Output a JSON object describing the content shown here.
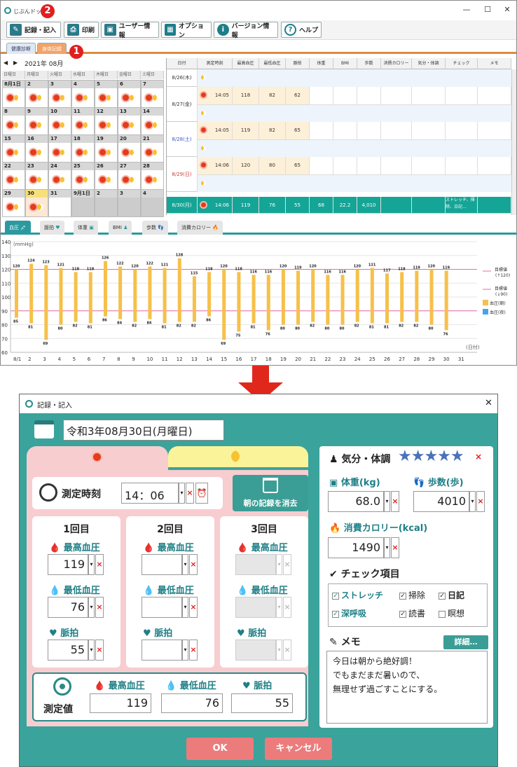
{
  "app": {
    "title": "じぶんドック"
  },
  "window_controls": {
    "minimize": "—",
    "maximize": "☐",
    "close": "✕"
  },
  "toolbar": {
    "buttons": [
      {
        "label": "記録・記入",
        "icon": "record-edit-icon"
      },
      {
        "label": "印刷",
        "icon": "printer-icon"
      },
      {
        "label": "ユーザー情報",
        "icon": "user-card-icon"
      },
      {
        "label": "オプション",
        "icon": "grid-icon"
      },
      {
        "label": "バージョン情報",
        "icon": "info-icon"
      },
      {
        "label": "ヘルプ",
        "icon": "help-icon"
      }
    ]
  },
  "annotations": {
    "badge1": "1",
    "badge2": "2"
  },
  "mode_tabs": [
    {
      "label": "健康診断"
    },
    {
      "label": "身体記録"
    }
  ],
  "calendar": {
    "month": "2021年 08月",
    "prev": "◀",
    "next": "▶",
    "dow": [
      "日曜日",
      "月曜日",
      "火曜日",
      "水曜日",
      "木曜日",
      "金曜日",
      "土曜日"
    ],
    "weeks": [
      [
        "8月1日",
        "2",
        "3",
        "4",
        "5",
        "6",
        "7"
      ],
      [
        "8",
        "9",
        "10",
        "11",
        "12",
        "13",
        "14"
      ],
      [
        "15",
        "16",
        "17",
        "18",
        "19",
        "20",
        "21"
      ],
      [
        "22",
        "23",
        "24",
        "25",
        "26",
        "27",
        "28"
      ],
      [
        "29",
        "30",
        "31",
        "9月1日",
        "2",
        "3",
        "4"
      ]
    ]
  },
  "grid": {
    "headers": [
      "日付",
      "測定時刻",
      "最高血圧",
      "最低血圧",
      "脈拍",
      "体重",
      "BMI",
      "歩数",
      "消費カロリー",
      "気分・体調",
      "チェック",
      "メモ"
    ],
    "rows": [
      {
        "date": "8/26(木)",
        "time": "",
        "sys": "",
        "dia": "",
        "pulse": "",
        "night": true
      },
      {
        "date": "8/27(金)",
        "time": "14:05",
        "sys": "118",
        "dia": "82",
        "pulse": "62"
      },
      {
        "date": "8/28(土)",
        "time": "14:05",
        "sys": "119",
        "dia": "82",
        "pulse": "65"
      },
      {
        "date": "8/29(日)",
        "time": "14:06",
        "sys": "120",
        "dia": "80",
        "pulse": "65"
      },
      {
        "date": "8/30(月)",
        "time": "14:06",
        "sys": "119",
        "dia": "76",
        "pulse": "55",
        "weight": "68",
        "bmi": "22.2",
        "steps": "4,010",
        "check": "ストレッチ、掃除、日記…"
      }
    ]
  },
  "chart_tabs": [
    {
      "label": "血圧"
    },
    {
      "label": "脈拍"
    },
    {
      "label": "体重"
    },
    {
      "label": "BMI"
    },
    {
      "label": "歩数"
    },
    {
      "label": "消費カロリー"
    }
  ],
  "chart_data": {
    "type": "bar",
    "ylabel": "(mmHg)",
    "xlabel": "(日付)",
    "ylim": [
      60,
      140
    ],
    "yticks": [
      60,
      70,
      80,
      90,
      100,
      110,
      120,
      130,
      140
    ],
    "categories": [
      "8/1",
      "2",
      "3",
      "4",
      "5",
      "6",
      "7",
      "8",
      "9",
      "10",
      "11",
      "12",
      "13",
      "14",
      "15",
      "16",
      "17",
      "18",
      "19",
      "20",
      "21",
      "22",
      "23",
      "24",
      "25",
      "26",
      "27",
      "28",
      "29",
      "30",
      "31"
    ],
    "series": [
      {
        "name": "血圧(朝)",
        "high": [
          120,
          124,
          123,
          121,
          118,
          118,
          126,
          122,
          120,
          122,
          121,
          128,
          115,
          118,
          120,
          118,
          116,
          116,
          120,
          119,
          120,
          116,
          116,
          120,
          121,
          117,
          118,
          119,
          120,
          119,
          null
        ],
        "low": [
          85,
          81,
          69,
          80,
          82,
          81,
          86,
          84,
          82,
          84,
          81,
          82,
          82,
          86,
          69,
          75,
          81,
          76,
          80,
          80,
          82,
          80,
          80,
          82,
          81,
          81,
          82,
          82,
          80,
          76,
          null
        ]
      },
      {
        "name": "血圧(夜)",
        "high": [],
        "low": []
      }
    ],
    "target_lines": [
      {
        "label": "目標値",
        "sub": "(↑120)",
        "value": 120
      },
      {
        "label": "目標値",
        "sub": "(↓90)",
        "value": 90
      }
    ],
    "colors": {
      "morning": "#f6c04a",
      "night": "#4aa3e8",
      "target": "#e86aa8"
    },
    "legend": "right"
  },
  "dialog": {
    "title": "記録・記入",
    "date": "令和3年08月30日(月曜日)",
    "time_label": "測定時刻",
    "time_value": "14：06",
    "clear_label": "朝の記録を消去",
    "rounds": [
      {
        "title": "1回目",
        "sys": "119",
        "dia": "76",
        "pulse": "55"
      },
      {
        "title": "2回目",
        "sys": "",
        "dia": "",
        "pulse": ""
      },
      {
        "title": "3回目",
        "sys": "",
        "dia": "",
        "pulse": ""
      }
    ],
    "sys_label": "最高血圧",
    "dia_label": "最低血圧",
    "pulse_label": "脈拍",
    "measured_label": "測定値",
    "measured": {
      "sys": "119",
      "dia": "76",
      "pulse": "55"
    },
    "mood_label": "気分・体調",
    "stars": "★★★★★",
    "weight_label": "体重(kg)",
    "weight": "68.0",
    "steps_label": "歩数(歩)",
    "steps": "4010",
    "cal_label": "消費カロリー(kcal)",
    "cal": "1490",
    "check_label": "チェック項目",
    "checks": [
      {
        "label": "ストレッチ",
        "checked": true
      },
      {
        "label": "掃除",
        "checked": true
      },
      {
        "label": "日記",
        "checked": true
      },
      {
        "label": "深呼吸",
        "checked": true
      },
      {
        "label": "読書",
        "checked": true
      },
      {
        "label": "瞑想",
        "checked": false
      }
    ],
    "memo_label": "メモ",
    "memo_detail": "詳細…",
    "memo": [
      "今日は朝から絶好調！",
      "でもまだまだ暑いので、",
      "無理せず過ごすことにする。"
    ],
    "ok": "OK",
    "cancel": "キャンセル"
  }
}
